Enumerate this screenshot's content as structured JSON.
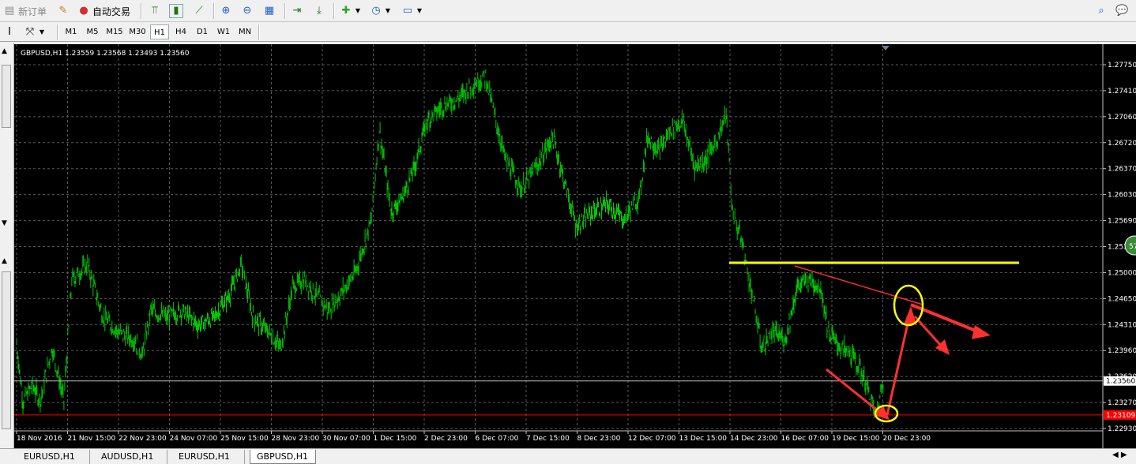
{
  "toolbar": {
    "new_order": "新订单",
    "auto_trade": "自动交易"
  },
  "timeframes": [
    "M1",
    "M5",
    "M15",
    "M30",
    "H1",
    "H4",
    "D1",
    "W1",
    "MN"
  ],
  "active_timeframe": "H1",
  "chart": {
    "info": "GBPUSD,H1  1.23559 1.23568 1.23493 1.23560",
    "price_labels": [
      "1.27750",
      "1.27410",
      "1.27060",
      "1.26720",
      "1.26370",
      "1.26030",
      "1.25690",
      "1.2535",
      "1.25000",
      "1.24650",
      "1.24310",
      "1.23960",
      "1.23620",
      "1.23270",
      "1.22930"
    ],
    "current_price": "1.23560",
    "red_line_price": "1.23109",
    "date_labels": [
      "18 Nov 2016",
      "21 Nov 15:00",
      "22 Nov 23:00",
      "24 Nov 07:00",
      "25 Nov 15:00",
      "28 Nov 23:00",
      "30 Nov 07:00",
      "1 Dec 15:00",
      "2 Dec 23:00",
      "6 Dec 07:00",
      "7 Dec 15:00",
      "8 Dec 23:00",
      "12 Dec 07:00",
      "13 Dec 15:00",
      "14 Dec 23:00",
      "16 Dec 07:00",
      "19 Dec 15:00",
      "20 Dec 23:00"
    ],
    "side_badge": "57",
    "colors": {
      "background": "#000000",
      "bars": "#00c800",
      "grid": "#5a5a5a",
      "support_line": "#ffff00",
      "annotation": "#ff3030",
      "current_price_line": "#c0c0c0",
      "red_line": "#ff0000"
    }
  },
  "tabs": [
    "EURUSD,H1",
    "AUDUSD,H1",
    "EURUSD,H1",
    "GBPUSD,H1"
  ],
  "active_tab": "GBPUSD,H1"
}
